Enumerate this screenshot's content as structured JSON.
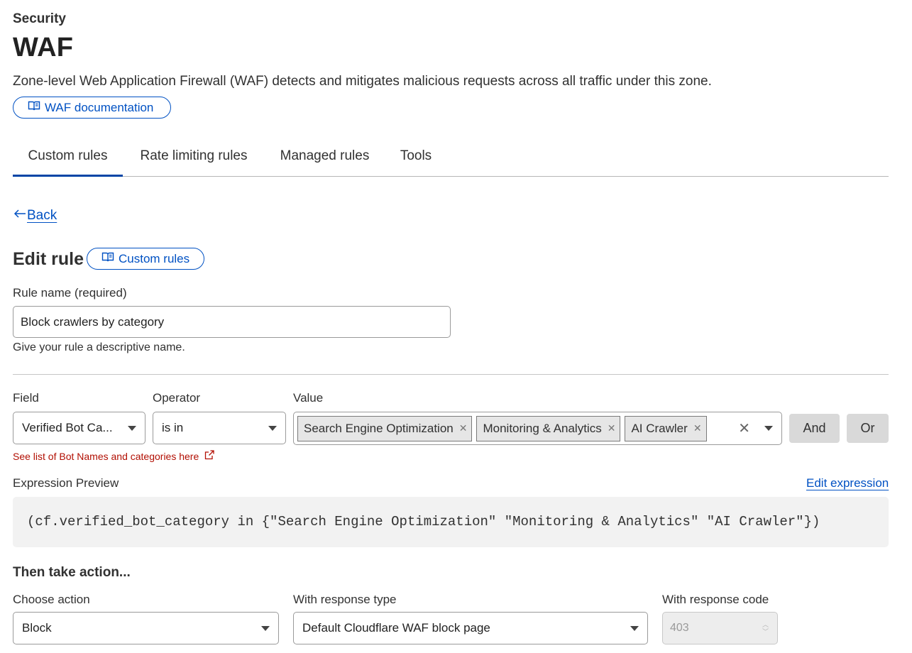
{
  "header": {
    "section": "Security",
    "title": "WAF",
    "description": "Zone-level Web Application Firewall (WAF) detects and mitigates malicious requests across all traffic under this zone.",
    "doc_link": "WAF documentation"
  },
  "tabs": [
    {
      "label": "Custom rules",
      "active": true
    },
    {
      "label": "Rate limiting rules",
      "active": false
    },
    {
      "label": "Managed rules",
      "active": false
    },
    {
      "label": "Tools",
      "active": false
    }
  ],
  "back": {
    "label": "Back"
  },
  "edit_rule": {
    "title": "Edit rule",
    "doc_link": "Custom rules",
    "rule_name_label": "Rule name (required)",
    "rule_name_value": "Block crawlers by category",
    "rule_name_hint": "Give your rule a descriptive name."
  },
  "expression_builder": {
    "field_label": "Field",
    "operator_label": "Operator",
    "value_label": "Value",
    "field_value": "Verified Bot Ca...",
    "operator_value": "is in",
    "values": [
      "Search Engine Optimization",
      "Monitoring & Analytics",
      "AI Crawler"
    ],
    "and_button": "And",
    "or_button": "Or",
    "bot_list_link": "See list of Bot Names and categories here"
  },
  "expression_preview": {
    "label": "Expression Preview",
    "edit_link": "Edit expression",
    "expression": "(cf.verified_bot_category in {\"Search Engine Optimization\" \"Monitoring & Analytics\" \"AI Crawler\"})"
  },
  "action": {
    "title": "Then take action...",
    "choose_action_label": "Choose action",
    "choose_action_value": "Block",
    "response_type_label": "With response type",
    "response_type_value": "Default Cloudflare WAF block page",
    "response_code_label": "With response code",
    "response_code_value": "403"
  },
  "colors": {
    "link_blue": "#0051c3",
    "tab_active": "#0045a6",
    "error_red": "#b20f03",
    "preview_bg": "#f2f2f2"
  }
}
